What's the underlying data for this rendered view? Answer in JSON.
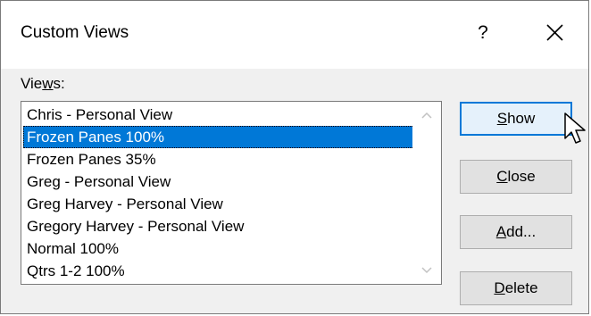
{
  "dialog": {
    "title": "Custom Views",
    "help_label": "?",
    "close_icon": "close-icon"
  },
  "views_label": {
    "prefix": "Vie",
    "mnemonic": "w",
    "suffix": "s:"
  },
  "views": {
    "items": [
      "Chris - Personal View",
      "Frozen Panes 100%",
      "Frozen Panes 35%",
      "Greg - Personal View",
      "Greg Harvey - Personal View",
      "Gregory Harvey - Personal View",
      "Normal 100%",
      "Qtrs 1-2 100%"
    ],
    "selected": "Frozen Panes 100%"
  },
  "buttons": {
    "show": {
      "mnemonic": "S",
      "rest": "how"
    },
    "close": {
      "mnemonic": "C",
      "rest": "lose"
    },
    "add": {
      "mnemonic": "A",
      "rest": "dd..."
    },
    "delete": {
      "mnemonic": "D",
      "rest": "elete"
    }
  },
  "colors": {
    "selection": "#0078d7",
    "default_button_border": "#0078d7",
    "default_button_bg": "#e5f1fb",
    "button_bg": "#e1e1e1",
    "dialog_bg": "#f0f0f0"
  }
}
